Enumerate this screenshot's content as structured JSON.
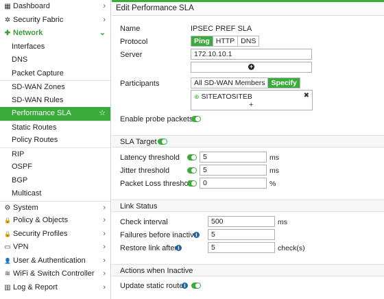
{
  "sidebar": {
    "items": [
      {
        "label": "Dashboard",
        "icon": "dashboard-icon",
        "glyph": "▦",
        "chevron": "›"
      },
      {
        "label": "Security Fabric",
        "icon": "fabric-icon",
        "glyph": "✲",
        "chevron": "›"
      },
      {
        "label": "Network",
        "icon": "network-icon",
        "glyph": "✚",
        "chevron": "⌄"
      },
      {
        "label": "Interfaces"
      },
      {
        "label": "DNS"
      },
      {
        "label": "Packet Capture"
      },
      {
        "label": "SD-WAN Zones"
      },
      {
        "label": "SD-WAN Rules"
      },
      {
        "label": "Performance SLA",
        "star": "☆"
      },
      {
        "label": "Static Routes"
      },
      {
        "label": "Policy Routes"
      },
      {
        "label": "RIP"
      },
      {
        "label": "OSPF"
      },
      {
        "label": "BGP"
      },
      {
        "label": "Multicast"
      },
      {
        "label": "System",
        "icon": "gear-icon",
        "glyph": "⚙",
        "chevron": "›"
      },
      {
        "label": "Policy & Objects",
        "icon": "lock-icon",
        "glyph": "🔒",
        "chevron": "›"
      },
      {
        "label": "Security Profiles",
        "icon": "shield-icon",
        "glyph": "🔒",
        "chevron": "›"
      },
      {
        "label": "VPN",
        "icon": "monitor-icon",
        "glyph": "▭",
        "chevron": "›"
      },
      {
        "label": "User & Authentication",
        "icon": "user-icon",
        "glyph": "👤",
        "chevron": "›"
      },
      {
        "label": "WiFi & Switch Controller",
        "icon": "wifi-icon",
        "glyph": "≋",
        "chevron": "›"
      },
      {
        "label": "Log & Report",
        "icon": "chart-icon",
        "glyph": "▥",
        "chevron": "›"
      }
    ]
  },
  "main": {
    "title": "Edit Performance SLA",
    "name_label": "Name",
    "name_value": "IPSEC PREF SLA",
    "protocol_label": "Protocol",
    "protocol_options": [
      "Ping",
      "HTTP",
      "DNS"
    ],
    "server_label": "Server",
    "server_value": "172.10.10.1",
    "plus_glyph": "+",
    "participants_label": "Participants",
    "participants_options": [
      "All SD-WAN Members",
      "Specify"
    ],
    "participant_entry": "SITEATOSITEB",
    "remove_glyph": "✖",
    "enable_probe_label": "Enable probe packets",
    "sla_target_header": "SLA Target",
    "latency_label": "Latency threshold",
    "latency_value": "5",
    "latency_unit": "ms",
    "jitter_label": "Jitter threshold",
    "jitter_value": "5",
    "jitter_unit": "ms",
    "loss_label": "Packet Loss threshold",
    "loss_value": "0",
    "loss_unit": "%",
    "link_status_header": "Link Status",
    "check_interval_label": "Check interval",
    "check_interval_value": "500",
    "check_interval_unit": "ms",
    "failures_label": "Failures before inactive",
    "failures_value": "5",
    "restore_label": "Restore link after",
    "restore_value": "5",
    "restore_unit": "check(s)",
    "actions_header": "Actions when Inactive",
    "update_static_label": "Update static route",
    "info_glyph": "i"
  },
  "colors": {
    "accent": "#3bab3b",
    "info": "#1f5fa8"
  }
}
